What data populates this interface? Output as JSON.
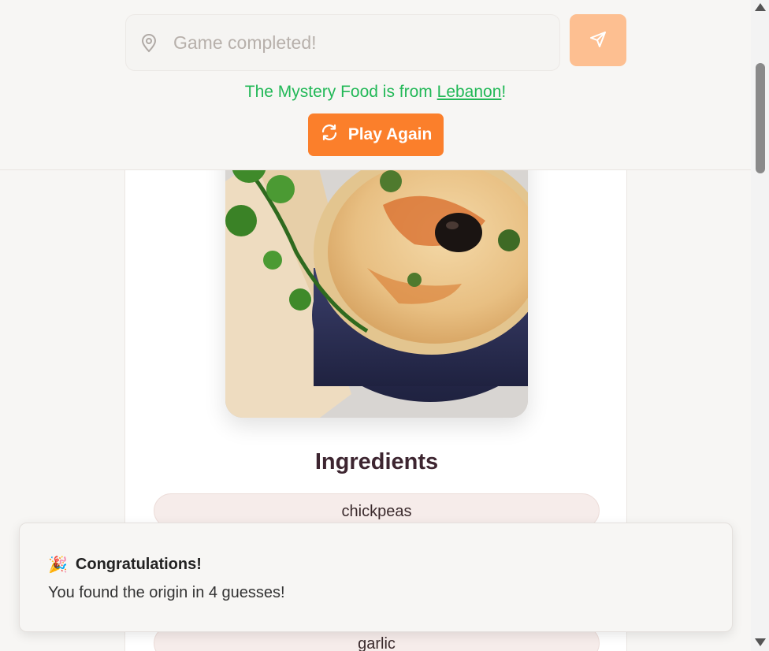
{
  "guess": {
    "placeholder": "Game completed!",
    "submit_icon": "send-icon",
    "location_icon": "map-pin-icon"
  },
  "result": {
    "prefix": "The Mystery Food is from ",
    "country": "Lebanon",
    "suffix": "!"
  },
  "play_again": {
    "label": "Play Again",
    "icon": "refresh-icon"
  },
  "ingredients": {
    "title": "Ingredients",
    "items": [
      "chickpeas",
      "garlic"
    ]
  },
  "toast": {
    "emoji": "🎉",
    "title": "Congratulations!",
    "message": "You found the origin in 4 guesses!"
  },
  "colors": {
    "accent": "#fb7f2b",
    "accent_light": "#fdbf91",
    "success": "#22b857",
    "heading": "#3d2530",
    "pill_bg": "#f6ecea"
  }
}
